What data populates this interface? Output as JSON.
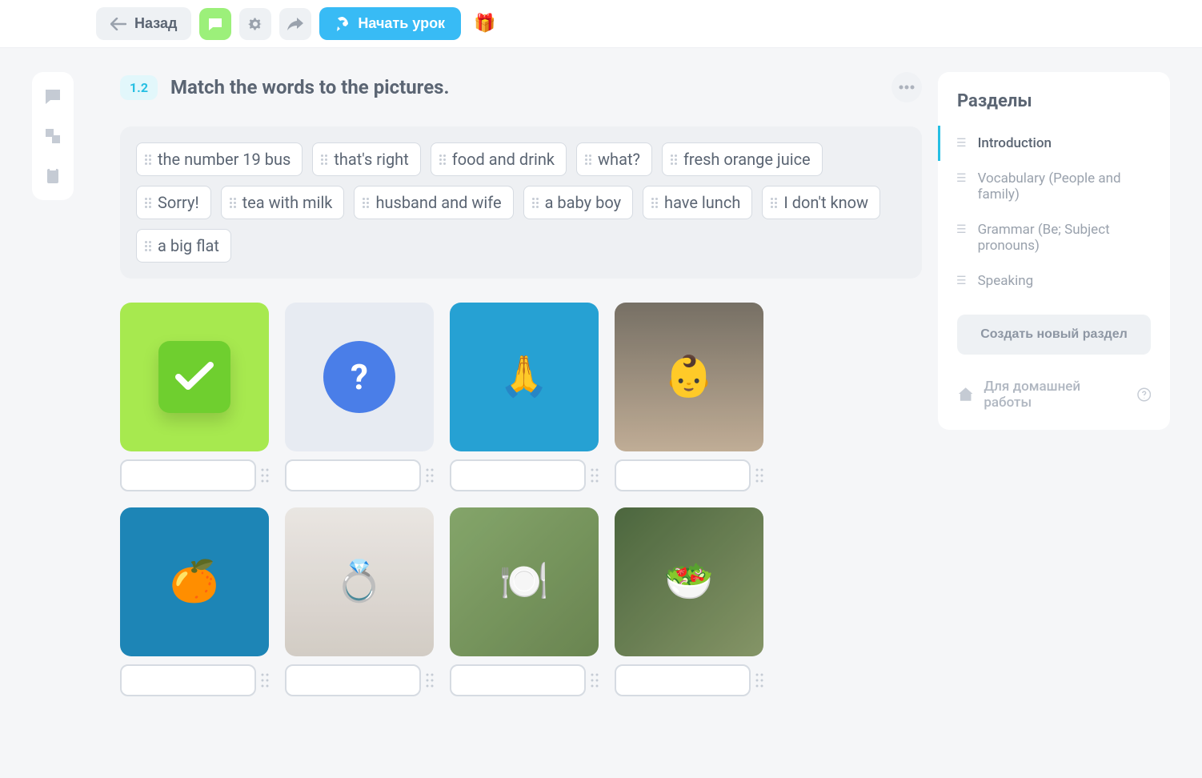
{
  "topbar": {
    "back_label": "Назад",
    "start_label": "Начать урок"
  },
  "task": {
    "number": "1.2",
    "title": "Match the words to the pictures."
  },
  "words": [
    "the number 19 bus",
    "that's right",
    "food and drink",
    "what?",
    "fresh orange juice",
    "Sorry!",
    "tea with milk",
    "husband and wife",
    "a baby boy",
    "have lunch",
    "I don't know",
    "a big flat"
  ],
  "images": [
    {
      "id": "check",
      "emoji": "✓"
    },
    {
      "id": "question",
      "emoji": "?"
    },
    {
      "id": "praying",
      "emoji": "🙏"
    },
    {
      "id": "baby",
      "emoji": "👶"
    },
    {
      "id": "oranges",
      "emoji": "🍊"
    },
    {
      "id": "hands",
      "emoji": "💍"
    },
    {
      "id": "lunch",
      "emoji": "🍽️"
    },
    {
      "id": "food",
      "emoji": "🥗"
    }
  ],
  "sidebar": {
    "title": "Разделы",
    "sections": [
      {
        "label": "Introduction",
        "active": true
      },
      {
        "label": "Vocabulary (People and family)",
        "active": false
      },
      {
        "label": "Grammar (Be; Subject pronouns)",
        "active": false
      },
      {
        "label": "Speaking",
        "active": false
      }
    ],
    "create_label": "Создать новый раздел",
    "homework_label": "Для домашней работы"
  }
}
